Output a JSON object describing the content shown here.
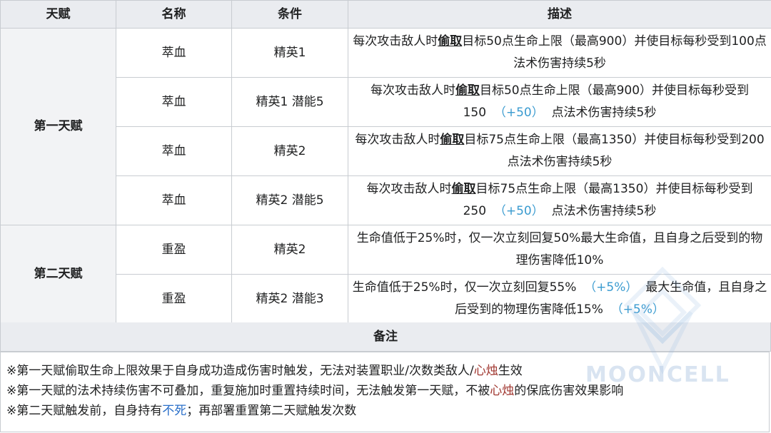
{
  "table": {
    "headers": [
      "天赋",
      "名称",
      "条件",
      "描述"
    ],
    "groups": [
      {
        "name": "第一天赋",
        "rows": [
          {
            "name": "萃血",
            "condition": "精英1",
            "desc": {
              "pre": "每次攻击敌人时",
              "link": "偷取",
              "mid": "目标50点生命上限（最高900）并使目标每秒受到100点法术伤害持续5秒",
              "bonus": "",
              "post": ""
            }
          },
          {
            "name": "萃血",
            "condition": "精英1 潜能5",
            "desc": {
              "pre": "每次攻击敌人时",
              "link": "偷取",
              "mid": "目标50点生命上限（最高900）并使目标每秒受到150",
              "bonus": "（+50）",
              "post": "点法术伤害持续5秒"
            }
          },
          {
            "name": "萃血",
            "condition": "精英2",
            "desc": {
              "pre": "每次攻击敌人时",
              "link": "偷取",
              "mid": "目标75点生命上限（最高1350）并使目标每秒受到200点法术伤害持续5秒",
              "bonus": "",
              "post": ""
            }
          },
          {
            "name": "萃血",
            "condition": "精英2 潜能5",
            "desc": {
              "pre": "每次攻击敌人时",
              "link": "偷取",
              "mid": "目标75点生命上限（最高1350）并使目标每秒受到250",
              "bonus": "（+50）",
              "post": "点法术伤害持续5秒"
            }
          }
        ]
      },
      {
        "name": "第二天赋",
        "rows": [
          {
            "name": "重盈",
            "condition": "精英2",
            "desc": {
              "pre": "生命值低于25%时，仅一次立刻回复50%最大生命值，且自身之后受到的物理伤害降低10%"
            }
          },
          {
            "name": "重盈",
            "condition": "精英2 潜能3",
            "desc": {
              "pre": "生命值低于25%时，仅一次立刻回复55%",
              "bonus1": "（+5%）",
              "mid": "最大生命值，且自身之后受到的物理伤害降低15%",
              "bonus2": "（+5%）"
            }
          }
        ]
      }
    ]
  },
  "notes": {
    "title": "备注",
    "lines": [
      {
        "a": "※第一天赋偷取生命上限效果于自身成功造成伤害时触发，无法对装置职业/次数类敌人/",
        "kw": "心烛",
        "b": "生效"
      },
      {
        "a": "※第一天赋的法术持续伤害不可叠加，重复施加时重置持续时间，无法触发第一天赋，不被",
        "kw": "心烛",
        "b": "的保底伤害效果影响"
      },
      {
        "a": "※第二天赋触发前，自身持有",
        "kw": "不死",
        "b": "；再部署重置第二天赋触发次数"
      }
    ]
  },
  "watermark": {
    "text": "MOONCELL"
  },
  "colors": {
    "header_bg": "#eaecf0",
    "border": "#c8ccd1",
    "bonus": "#3a9bd0",
    "keyword_red": "#a0362f",
    "keyword_blue": "#2a6fc9"
  }
}
